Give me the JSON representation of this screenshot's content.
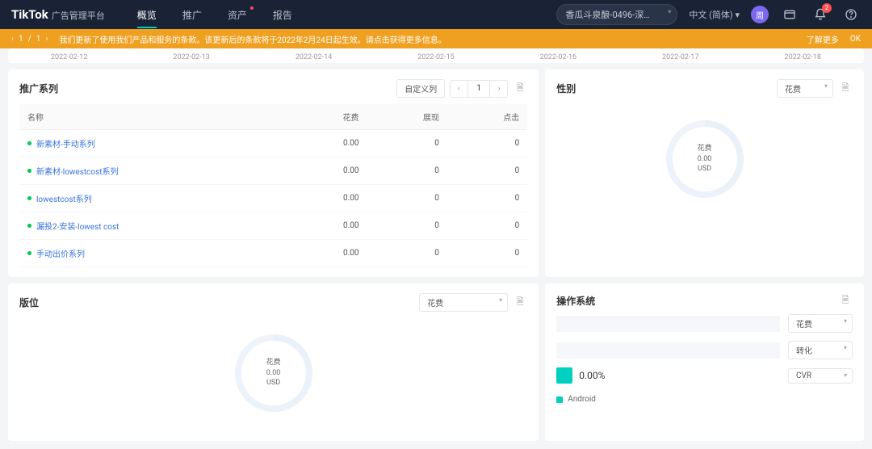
{
  "header": {
    "brand": "TikTok",
    "brand_sub": "广告管理平台",
    "nav": [
      "概览",
      "推广",
      "资产",
      "报告"
    ],
    "nav_active": 0,
    "nav_dot": 2,
    "account": "香瓜斗泉酿-0496-深…",
    "lang": "中文 (简体)",
    "avatar_letter": "周",
    "badge": "2"
  },
  "banner": {
    "page_current": "1",
    "page_total": "1",
    "text": "我们更新了使用我们产品和服务的条款。该更新后的条款将于2022年2月24日起生效。请点击获得更多信息。",
    "more": "了解更多",
    "ok": "OK"
  },
  "timeline": [
    "2022-02-12",
    "2022-02-13",
    "2022-02-14",
    "2022-02-15",
    "2022-02-16",
    "2022-02-17",
    "2022-02-18"
  ],
  "series": {
    "title": "推广系列",
    "custom_cols": "自定义列",
    "page_num": "1",
    "cols": [
      "名称",
      "花费",
      "展现",
      "点击"
    ],
    "rows": [
      {
        "name": "新素材-手动系列",
        "spend": "0.00",
        "imp": "0",
        "click": "0"
      },
      {
        "name": "新素材-lowestcost系列",
        "spend": "0.00",
        "imp": "0",
        "click": "0"
      },
      {
        "name": "lowestcost系列",
        "spend": "0.00",
        "imp": "0",
        "click": "0"
      },
      {
        "name": "漏投2-安装-lowest cost",
        "spend": "0.00",
        "imp": "0",
        "click": "0"
      },
      {
        "name": "手动出价系列",
        "spend": "0.00",
        "imp": "0",
        "click": "0"
      }
    ]
  },
  "gender": {
    "title": "性别",
    "metric": "花费",
    "center_label": "花费",
    "center_value": "0.00",
    "center_currency": "USD"
  },
  "placement": {
    "title": "版位",
    "metric": "花费",
    "center_label": "花费",
    "center_value": "0.00",
    "center_currency": "USD"
  },
  "os": {
    "title": "操作系统",
    "selects": [
      "花费",
      "转化",
      "CVR"
    ],
    "pct": "0.00%",
    "legend": "Android"
  }
}
